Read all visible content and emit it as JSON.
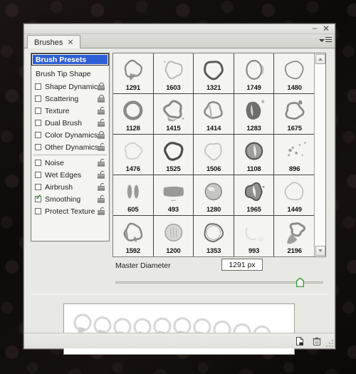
{
  "window": {
    "tab_label": "Brushes",
    "tab_close_icon": "close-icon",
    "minimize_label": "–",
    "close_label": "✕",
    "panel_menu_icon": "panel-menu-icon"
  },
  "sidebar": {
    "selected": "Brush Presets",
    "items": [
      {
        "label": "Brush Presets",
        "type": "header-selected",
        "checkbox": null,
        "lock": null
      },
      {
        "label": "Brush Tip Shape",
        "type": "header",
        "checkbox": null,
        "lock": null
      },
      {
        "label": "Shape Dynamics",
        "type": "option",
        "checkbox": false,
        "lock": "closed"
      },
      {
        "label": "Scattering",
        "type": "option",
        "checkbox": false,
        "lock": "closed"
      },
      {
        "label": "Texture",
        "type": "option",
        "checkbox": false,
        "lock": "open"
      },
      {
        "label": "Dual Brush",
        "type": "option",
        "checkbox": false,
        "lock": "open"
      },
      {
        "label": "Color Dynamics",
        "type": "option",
        "checkbox": false,
        "lock": "closed"
      },
      {
        "label": "Other Dynamics",
        "type": "option",
        "checkbox": false,
        "lock": "open"
      },
      {
        "label": "Noise",
        "type": "option",
        "checkbox": false,
        "lock": "open",
        "separator_before": true
      },
      {
        "label": "Wet Edges",
        "type": "option",
        "checkbox": false,
        "lock": "open"
      },
      {
        "label": "Airbrush",
        "type": "option",
        "checkbox": false,
        "lock": "open"
      },
      {
        "label": "Smoothing",
        "type": "option",
        "checkbox": true,
        "lock": "open"
      },
      {
        "label": "Protect Texture",
        "type": "option",
        "checkbox": false,
        "lock": "open"
      }
    ]
  },
  "brush_grid": {
    "columns": 5,
    "rows": 5,
    "selected_index": 0,
    "presets": [
      {
        "size": "1291",
        "shape": "ring-tail"
      },
      {
        "size": "1603",
        "shape": "ring-faint"
      },
      {
        "size": "1321",
        "shape": "ring-bold"
      },
      {
        "size": "1749",
        "shape": "ring-oval"
      },
      {
        "size": "1480",
        "shape": "ring-thin"
      },
      {
        "size": "1128",
        "shape": "ring-thick"
      },
      {
        "size": "1415",
        "shape": "ring-splash"
      },
      {
        "size": "1414",
        "shape": "ring-smudge"
      },
      {
        "size": "1283",
        "shape": "blob-dark"
      },
      {
        "size": "1675",
        "shape": "ring-drip"
      },
      {
        "size": "1476",
        "shape": "ring-pale"
      },
      {
        "size": "1525",
        "shape": "ring-solid"
      },
      {
        "size": "1506",
        "shape": "ring-light"
      },
      {
        "size": "1108",
        "shape": "ring-filled"
      },
      {
        "size": "896",
        "shape": "spatter"
      },
      {
        "size": "605",
        "shape": "two-bars"
      },
      {
        "size": "493",
        "shape": "rect-smudge"
      },
      {
        "size": "1280",
        "shape": "disc"
      },
      {
        "size": "1965",
        "shape": "blob-ring"
      },
      {
        "size": "1449",
        "shape": "ring-outline"
      },
      {
        "size": "1592",
        "shape": "ring-broken"
      },
      {
        "size": "1200",
        "shape": "disc-texture"
      },
      {
        "size": "1353",
        "shape": "ring-double"
      },
      {
        "size": "993",
        "shape": "ring-ghost"
      },
      {
        "size": "2196",
        "shape": "ring-blot"
      }
    ]
  },
  "scrollbar": {
    "up_icon": "chevron-up-icon",
    "down_icon": "chevron-down-icon"
  },
  "master_diameter": {
    "label": "Master Diameter",
    "value": "1291 px",
    "slider_percent": 86
  },
  "stroke_preview": {
    "stamp_count": 10,
    "shape": "ring-tail"
  },
  "footer": {
    "new_brush_icon": "new-brush-icon",
    "delete_brush_icon": "trash-icon",
    "resize_grip_icon": "resize-grip-icon"
  },
  "colors": {
    "selection_blue": "#2f5fd4",
    "panel_bg": "#e8e8e4",
    "list_bg": "#f4f4f1",
    "grid_bg": "#f4f4f2",
    "slider_green": "#3f9c3f",
    "check_green": "#1d8a2a"
  }
}
